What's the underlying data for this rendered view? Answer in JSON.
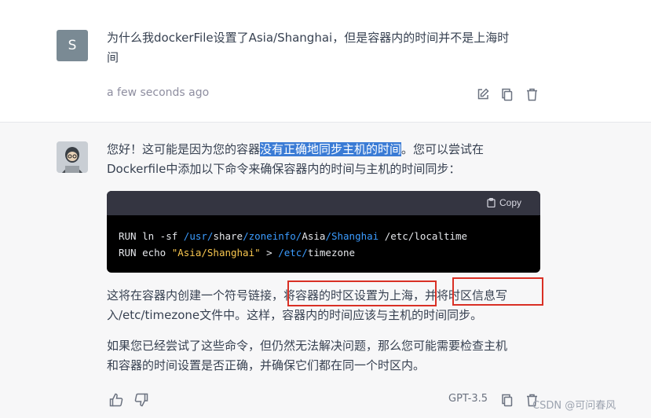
{
  "user": {
    "avatar_letter": "S",
    "message_line1": "为什么我dockerFile设置了Asia/Shanghai，但是容器内的时间并不是上海时",
    "message_line2": "间",
    "timestamp": "a few seconds ago"
  },
  "assistant": {
    "p1_prefix": "您好！这可能是因为您的容器",
    "p1_highlight": "没有正确地同步主机的时间",
    "p1_suffix": "。您可以尝试在",
    "p1_line2": "Dockerfile中添加以下命令来确保容器内的时间与主机的时间同步：",
    "code_copy_label": "Copy",
    "p2_a": "这将在容器内创建一个符号链接，",
    "p2_b": "将容器的时区设置为上海",
    "p2_c": "，并",
    "p2_d": "将时区信息写",
    "p2_line2": "入/etc/timezone文件中。这样，容器内的时间应该与主机的时间同步。",
    "p3_line1": "如果您已经尝试了这些命令，但仍然无法解决问题，那么您可能需要检查主机",
    "p3_line2": "和容器的时间设置是否正确，并确保它们都在同一个时区内。",
    "model": "GPT-3.5"
  },
  "code": {
    "l1_cmd": "RUN ln -sf ",
    "l1_p1": "/usr/",
    "l1_p2": "share",
    "l1_p3": "/zoneinfo/",
    "l1_p4": "Asia",
    "l1_p5": "/Shanghai",
    "l1_p6": " /etc/localtime",
    "l2_cmd": "RUN echo ",
    "l2_str": "\"Asia/Shanghai\"",
    "l2_gt": " > ",
    "l2_path": "/etc/",
    "l2_rest": "timezone"
  },
  "watermark": "CSDN @可问春风",
  "colors": {
    "highlight": "#3a7bd5",
    "annotation_red": "#d93025",
    "ai_background": "#f7f7f8",
    "code_background": "#000000"
  }
}
